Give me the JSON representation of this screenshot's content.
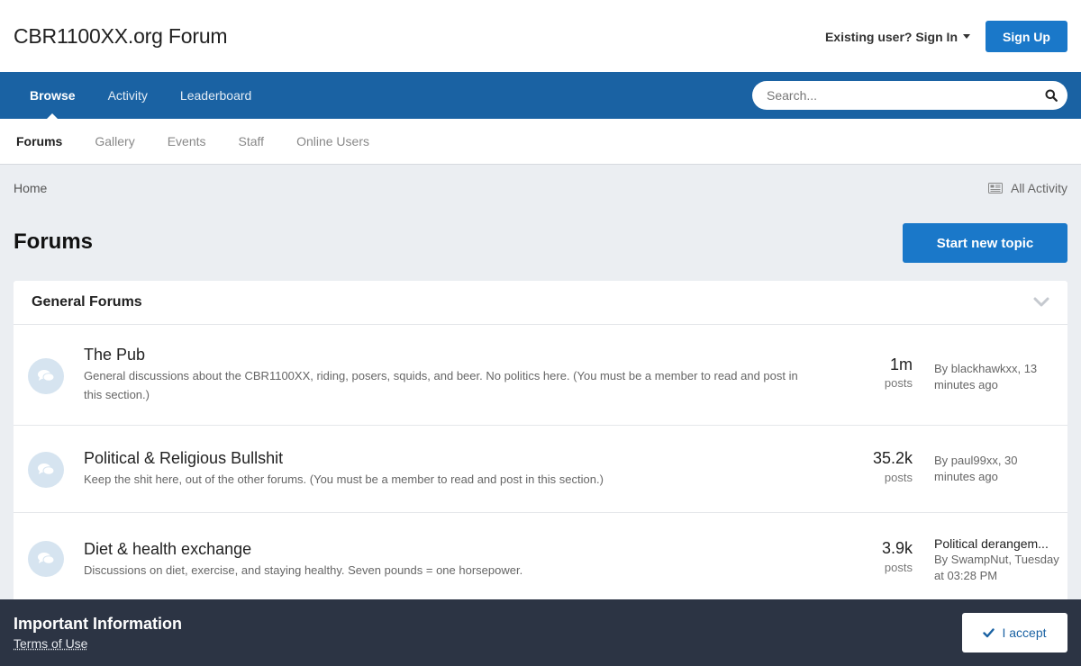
{
  "header": {
    "site_title": "CBR1100XX.org Forum",
    "signin_label": "Existing user? Sign In",
    "signup_label": "Sign Up"
  },
  "nav": {
    "items": [
      {
        "label": "Browse",
        "active": true
      },
      {
        "label": "Activity",
        "active": false
      },
      {
        "label": "Leaderboard",
        "active": false
      }
    ],
    "search_placeholder": "Search..."
  },
  "secondary_nav": {
    "items": [
      {
        "label": "Forums",
        "active": true
      },
      {
        "label": "Gallery",
        "active": false
      },
      {
        "label": "Events",
        "active": false
      },
      {
        "label": "Staff",
        "active": false
      },
      {
        "label": "Online Users",
        "active": false
      }
    ]
  },
  "breadcrumb": {
    "home": "Home",
    "all_activity": "All Activity"
  },
  "page": {
    "title": "Forums",
    "start_topic_label": "Start new topic"
  },
  "forum_block": {
    "title": "General Forums",
    "forums": [
      {
        "name": "The Pub",
        "description": "General discussions about the CBR1100XX, riding, posers, squids, and beer.  No politics here.  (You must be a member to read and post in this section.)",
        "posts_count": "1m",
        "posts_label": "posts",
        "last_by": "By blackhawkxx, 13 minutes ago"
      },
      {
        "name": "Political & Religious Bullshit",
        "description": "Keep the shit here, out of the other forums.  (You must be a member to read and post in this section.)",
        "posts_count": "35.2k",
        "posts_label": "posts",
        "last_by": "By paul99xx, 30 minutes ago"
      },
      {
        "name": "Diet & health exchange",
        "description": "Discussions on diet, exercise, and staying healthy.  Seven pounds = one horsepower.",
        "posts_count": "3.9k",
        "posts_label": "posts",
        "last_title": "Political derangem...",
        "last_by": "By SwampNut, Tuesday at 03:28 PM"
      }
    ]
  },
  "banner": {
    "title": "Important Information",
    "terms_link": "Terms of Use",
    "accept_label": "I accept"
  },
  "colors": {
    "primary_blue": "#1a78c9",
    "nav_blue": "#1a62a3",
    "banner_dark": "#2c3444",
    "page_bg": "#ebeef2"
  }
}
